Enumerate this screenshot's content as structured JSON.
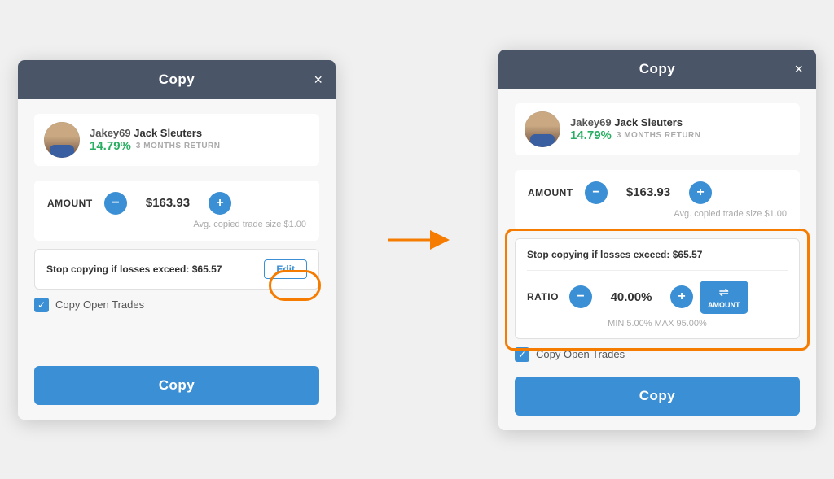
{
  "dialog1": {
    "title": "Copy",
    "close_label": "×",
    "user": {
      "username": "Jakey69",
      "fullname": "Jack Sleuters",
      "return_pct": "14.79%",
      "return_label": "3 MONTHS RETURN"
    },
    "amount_label": "AMOUNT",
    "amount_value": "$163.93",
    "avg_note": "Avg. copied trade size $1.00",
    "stop_loss_text": "Stop copying if losses exceed:",
    "stop_loss_value": "$65.57",
    "edit_label": "Edit",
    "copy_trades_label": "Copy Open Trades",
    "copy_button_label": "Copy"
  },
  "dialog2": {
    "title": "Copy",
    "close_label": "×",
    "user": {
      "username": "Jakey69",
      "fullname": "Jack Sleuters",
      "return_pct": "14.79%",
      "return_label": "3 MONTHS RETURN"
    },
    "amount_label": "AMOUNT",
    "amount_value": "$163.93",
    "avg_note": "Avg. copied trade size $1.00",
    "stop_loss_text": "Stop copying if losses exceed:",
    "stop_loss_value": "$65.57",
    "ratio_label": "RATIO",
    "ratio_value": "40.00%",
    "ratio_minmax": "MIN 5.00% MAX 95.00%",
    "amount_toggle_label": "AMOUNT",
    "copy_trades_label": "Copy Open Trades",
    "copy_button_label": "Copy"
  },
  "icons": {
    "minus": "−",
    "plus": "+",
    "check": "✓",
    "close": "×",
    "transfer": "⇌"
  }
}
